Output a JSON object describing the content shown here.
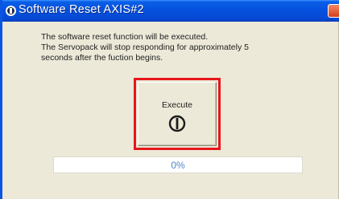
{
  "window": {
    "title": "Software Reset AXIS#2"
  },
  "message": {
    "lines": [
      "The software reset function will be executed.",
      "The Servopack will stop responding for approximately 5",
      "seconds after the fuction begins."
    ]
  },
  "execute_button": {
    "label": "Execute",
    "icon": "power-icon"
  },
  "progress": {
    "value_percent": 0,
    "text": "0%"
  },
  "colors": {
    "titlebar": "#0553e0",
    "highlight": "#e8161a",
    "progress_text": "#4f86c8"
  }
}
